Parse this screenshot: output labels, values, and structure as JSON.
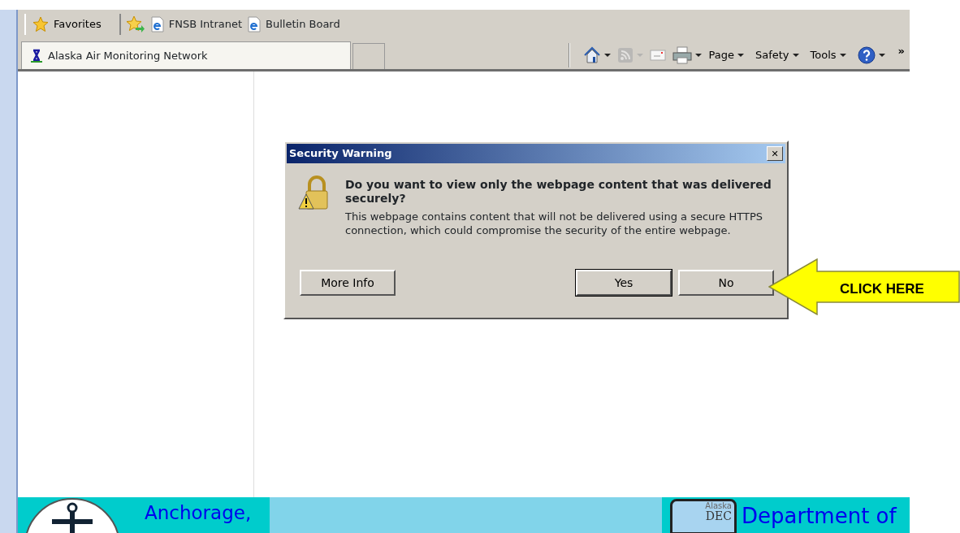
{
  "favorites_bar": {
    "favorites_button": "Favorites",
    "links": [
      "FNSB Intranet",
      "Bulletin Board"
    ]
  },
  "tabs": [
    {
      "label": "Alaska Air Monitoring Network",
      "selected": true
    },
    {
      "selected": false
    }
  ],
  "command_bar": {
    "items": [
      {
        "kind": "home",
        "disabled": false
      },
      {
        "kind": "feeds",
        "disabled": true
      },
      {
        "kind": "mail",
        "disabled": false
      },
      {
        "kind": "print",
        "disabled": false
      },
      {
        "kind": "menu",
        "label": "Page",
        "disabled": false
      },
      {
        "kind": "menu",
        "label": "Safety",
        "disabled": false
      },
      {
        "kind": "menu",
        "label": "Tools",
        "disabled": false
      },
      {
        "kind": "help",
        "disabled": false
      }
    ],
    "overflow": "»"
  },
  "page_banner": {
    "left_text": "Anchorage,",
    "right_logo": [
      "Alaska",
      "DEC"
    ],
    "right_text": "Department of"
  },
  "dialog": {
    "title": "Security Warning",
    "close": "✕",
    "question": "Do you want to view only the webpage content that was delivered securely?",
    "detail": "This webpage contains content that will not be delivered using a secure HTTPS connection, which could compromise the security of the entire webpage.",
    "buttons": [
      {
        "label": "More Info",
        "selected": false
      },
      {
        "label": "Yes",
        "selected": true
      },
      {
        "label": "No",
        "selected": false
      }
    ]
  },
  "callout": {
    "text": "CLICK HERE"
  }
}
